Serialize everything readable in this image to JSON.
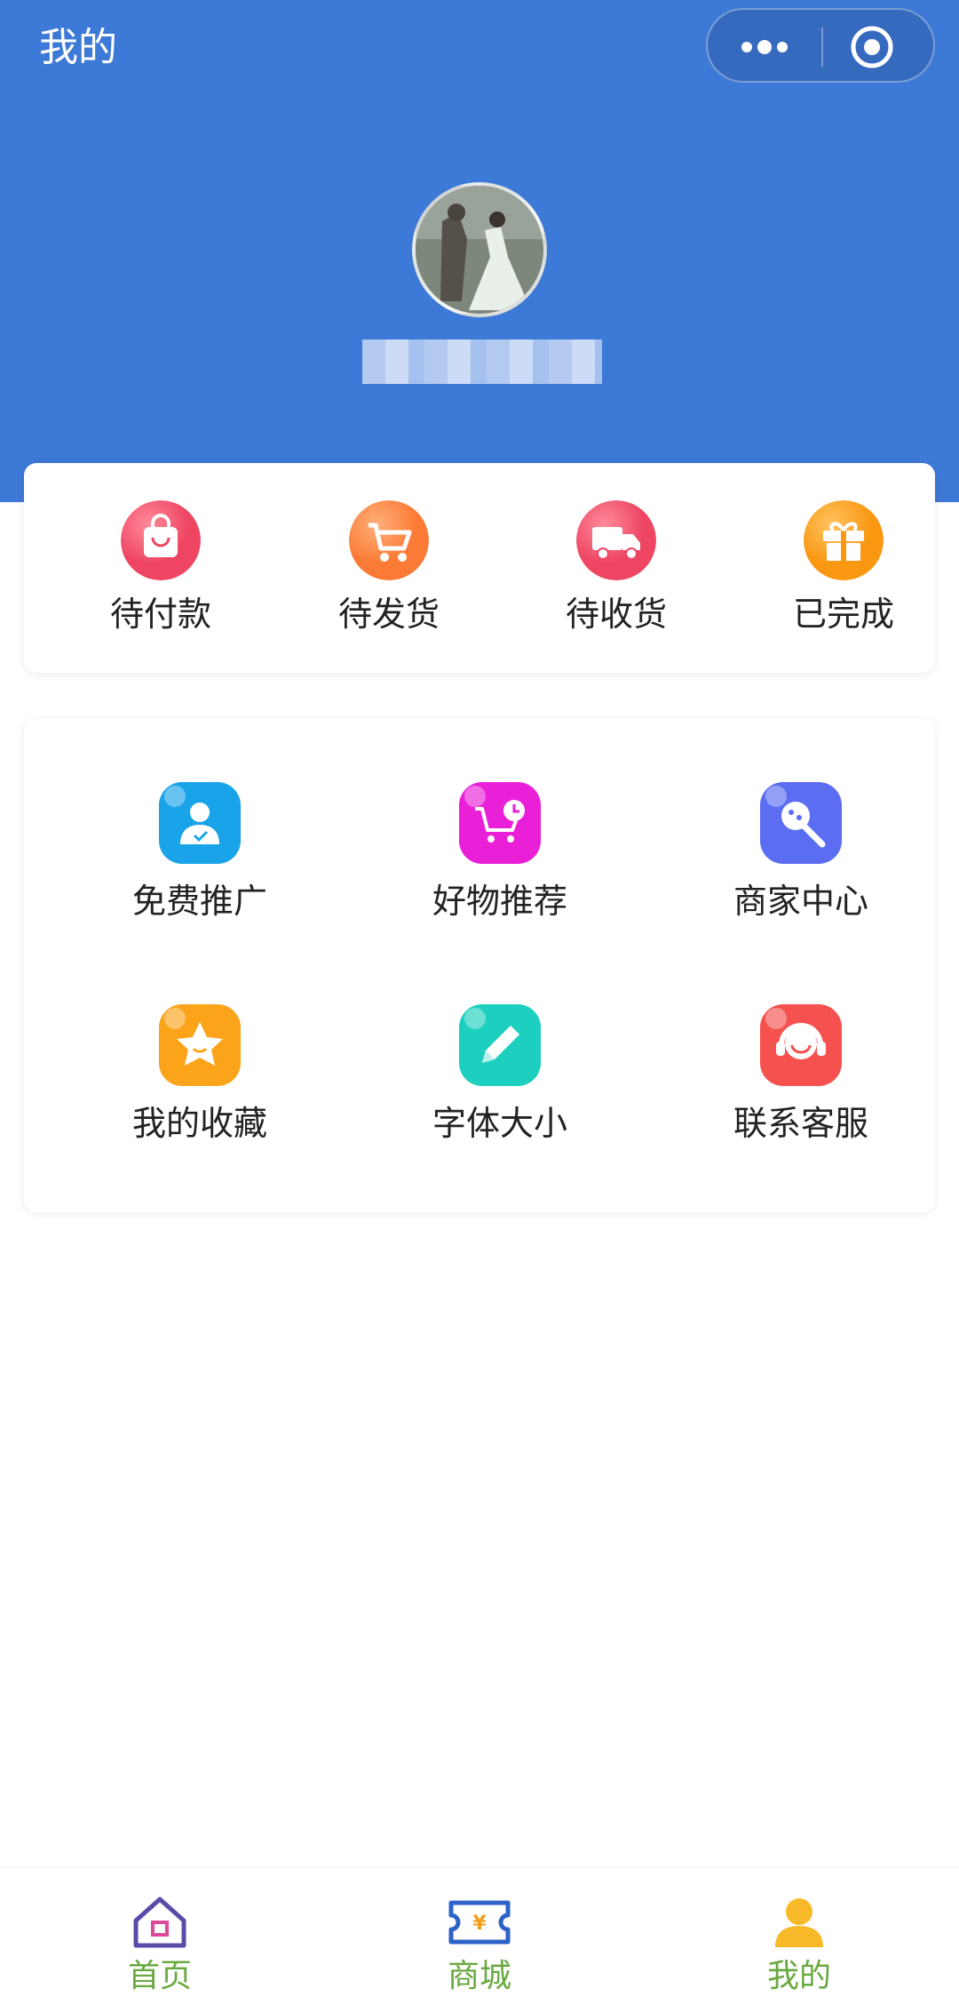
{
  "header": {
    "title": "我的",
    "bg_color": "#3d79d6"
  },
  "capsule": {
    "more_icon": "more-dots-icon",
    "close_icon": "target-circle-icon"
  },
  "profile": {
    "avatar": "user-avatar-photo",
    "nickname": ""
  },
  "orders": [
    {
      "label": "待付款",
      "icon": "shopping-bag-icon",
      "color": "#f0546b"
    },
    {
      "label": "待发货",
      "icon": "cart-icon",
      "color": "#fb8240"
    },
    {
      "label": "待收货",
      "icon": "delivery-truck-icon",
      "color": "#f0546b"
    },
    {
      "label": "已完成",
      "icon": "gift-icon",
      "color": "#fba21f"
    }
  ],
  "features": [
    {
      "label": "免费推广",
      "icon": "user-check-icon",
      "color": "#19a4ea"
    },
    {
      "label": "好物推荐",
      "icon": "cart-clock-icon",
      "color": "#ea1fd8"
    },
    {
      "label": "商家中心",
      "icon": "microphone-icon",
      "color": "#5b6ef2"
    },
    {
      "label": "我的收藏",
      "icon": "star-icon",
      "color": "#fba319"
    },
    {
      "label": "字体大小",
      "icon": "pencil-icon",
      "color": "#1dcfbe"
    },
    {
      "label": "联系客服",
      "icon": "headset-icon",
      "color": "#f5524f"
    }
  ],
  "tabbar": [
    {
      "label": "首页",
      "icon": "home-icon",
      "color": "#6aa840"
    },
    {
      "label": "商城",
      "icon": "ticket-yen-icon",
      "color": "#6aa840"
    },
    {
      "label": "我的",
      "icon": "user-icon",
      "color": "#6aa840",
      "active": true
    }
  ]
}
